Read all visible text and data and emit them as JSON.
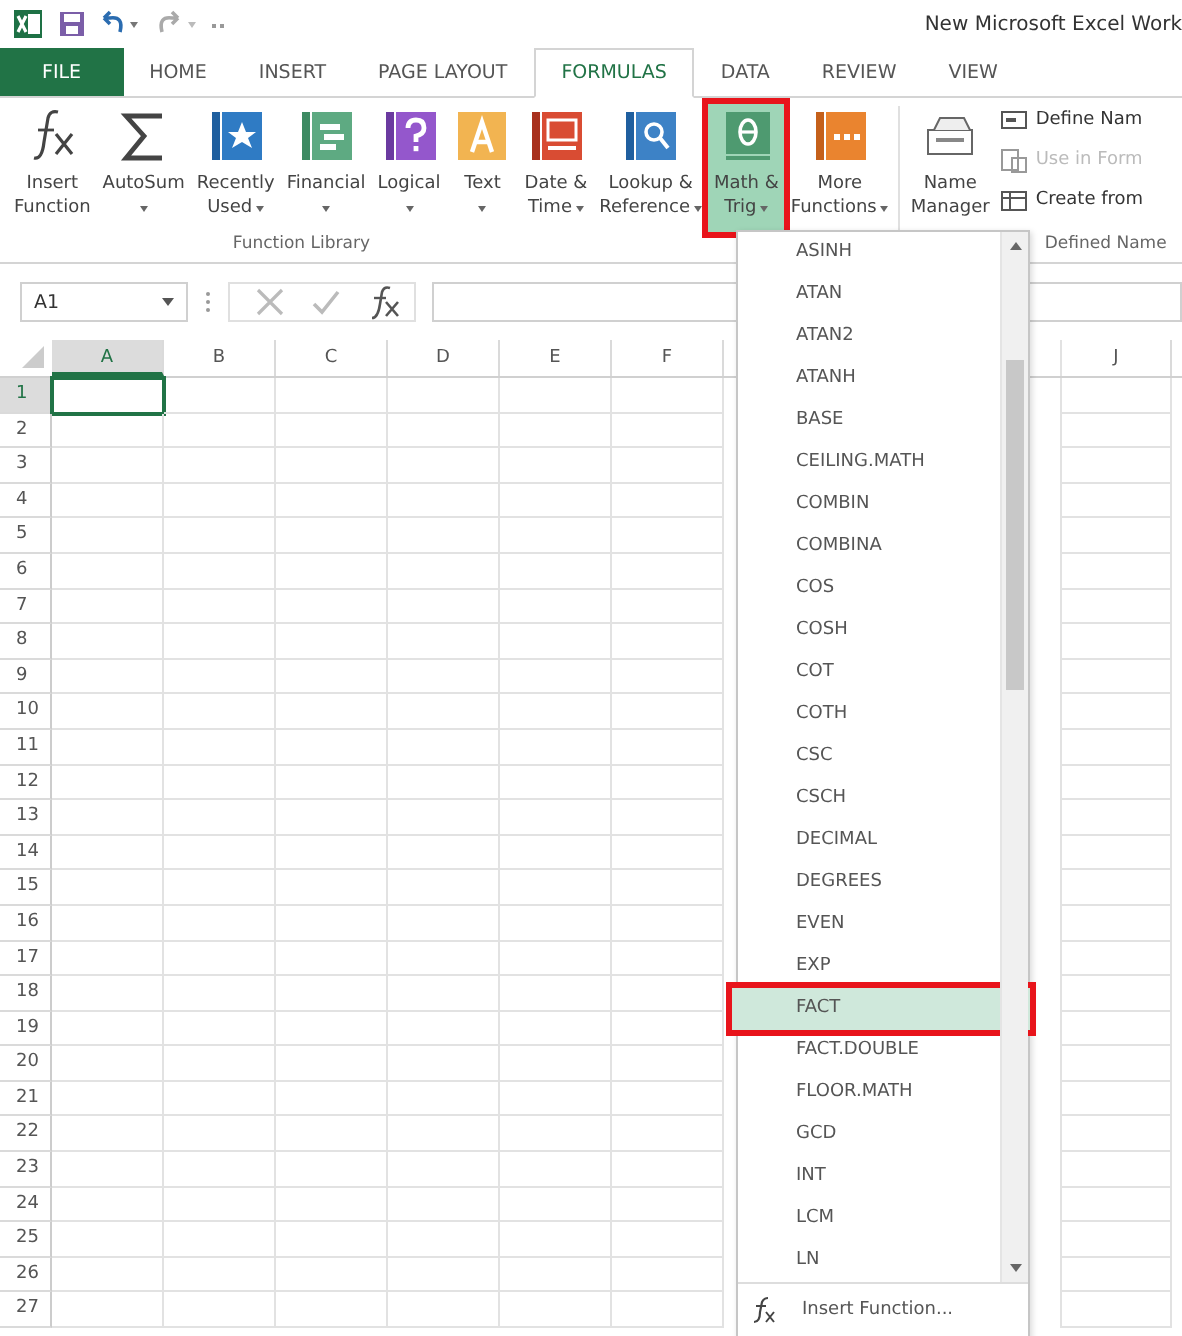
{
  "window": {
    "title": "New Microsoft Excel Work"
  },
  "tabs": [
    {
      "label": "FILE",
      "kind": "file",
      "selected": false
    },
    {
      "label": "HOME",
      "kind": "tab",
      "selected": false
    },
    {
      "label": "INSERT",
      "kind": "tab",
      "selected": false
    },
    {
      "label": "PAGE LAYOUT",
      "kind": "tab",
      "selected": false
    },
    {
      "label": "FORMULAS",
      "kind": "tab",
      "selected": true
    },
    {
      "label": "DATA",
      "kind": "tab",
      "selected": false
    },
    {
      "label": "REVIEW",
      "kind": "tab",
      "selected": false
    },
    {
      "label": "VIEW",
      "kind": "tab",
      "selected": false
    }
  ],
  "ribbon": {
    "function_library": {
      "label": "Function Library",
      "buttons": [
        {
          "lines": [
            "Insert",
            "Function"
          ],
          "kind": "fx",
          "dropdown": false,
          "selected": false,
          "annotated": false
        },
        {
          "lines": [
            "AutoSum"
          ],
          "kind": "sigma",
          "dropdown": true,
          "selected": false,
          "annotated": false
        },
        {
          "lines": [
            "Recently",
            "Used"
          ],
          "kind": "star",
          "dropdown": true,
          "selected": false,
          "annotated": false
        },
        {
          "lines": [
            "Financial"
          ],
          "kind": "financial",
          "dropdown": true,
          "selected": false,
          "annotated": false
        },
        {
          "lines": [
            "Logical"
          ],
          "kind": "logical",
          "dropdown": true,
          "selected": false,
          "annotated": false
        },
        {
          "lines": [
            "Text"
          ],
          "kind": "text",
          "dropdown": true,
          "selected": false,
          "annotated": false
        },
        {
          "lines": [
            "Date &",
            "Time"
          ],
          "kind": "date",
          "dropdown": true,
          "selected": false,
          "annotated": false
        },
        {
          "lines": [
            "Lookup &",
            "Reference"
          ],
          "kind": "lookup",
          "dropdown": true,
          "selected": false,
          "annotated": false
        },
        {
          "lines": [
            "Math &",
            "Trig"
          ],
          "kind": "math",
          "dropdown": true,
          "selected": true,
          "annotated": true
        },
        {
          "lines": [
            "More",
            "Functions"
          ],
          "kind": "more",
          "dropdown": true,
          "selected": false,
          "annotated": false
        }
      ]
    },
    "defined_names": {
      "label": "Defined Name",
      "name_manager": [
        "Name",
        "Manager"
      ],
      "items": [
        {
          "label": "Define Nam",
          "kind": "tag",
          "disabled": false
        },
        {
          "label": "Use in Form",
          "kind": "use",
          "disabled": true
        },
        {
          "label": "Create from",
          "kind": "grid",
          "disabled": false
        }
      ]
    }
  },
  "formula_bar": {
    "name_box": "A1"
  },
  "sheet": {
    "columns": [
      {
        "label": "A",
        "selected": true
      },
      {
        "label": "B",
        "selected": false
      },
      {
        "label": "C",
        "selected": false
      },
      {
        "label": "D",
        "selected": false
      },
      {
        "label": "E",
        "selected": false
      },
      {
        "label": "F",
        "selected": false
      },
      {
        "label": "J",
        "selected": false
      }
    ],
    "rows": [
      {
        "label": "1",
        "selected": true
      },
      {
        "label": "2",
        "selected": false
      },
      {
        "label": "3",
        "selected": false
      },
      {
        "label": "4",
        "selected": false
      },
      {
        "label": "5",
        "selected": false
      },
      {
        "label": "6",
        "selected": false
      },
      {
        "label": "7",
        "selected": false
      },
      {
        "label": "8",
        "selected": false
      },
      {
        "label": "9",
        "selected": false
      },
      {
        "label": "10",
        "selected": false
      },
      {
        "label": "11",
        "selected": false
      },
      {
        "label": "12",
        "selected": false
      },
      {
        "label": "13",
        "selected": false
      },
      {
        "label": "14",
        "selected": false
      },
      {
        "label": "15",
        "selected": false
      },
      {
        "label": "16",
        "selected": false
      },
      {
        "label": "17",
        "selected": false
      },
      {
        "label": "18",
        "selected": false
      },
      {
        "label": "19",
        "selected": false
      },
      {
        "label": "20",
        "selected": false
      },
      {
        "label": "21",
        "selected": false
      },
      {
        "label": "22",
        "selected": false
      },
      {
        "label": "23",
        "selected": false
      },
      {
        "label": "24",
        "selected": false
      },
      {
        "label": "25",
        "selected": false
      },
      {
        "label": "26",
        "selected": false
      },
      {
        "label": "27",
        "selected": false
      }
    ]
  },
  "dropdown": {
    "items": [
      {
        "label": "ASINH",
        "selected": false,
        "annotated": false
      },
      {
        "label": "ATAN",
        "selected": false,
        "annotated": false
      },
      {
        "label": "ATAN2",
        "selected": false,
        "annotated": false
      },
      {
        "label": "ATANH",
        "selected": false,
        "annotated": false
      },
      {
        "label": "BASE",
        "selected": false,
        "annotated": false
      },
      {
        "label": "CEILING.MATH",
        "selected": false,
        "annotated": false
      },
      {
        "label": "COMBIN",
        "selected": false,
        "annotated": false
      },
      {
        "label": "COMBINA",
        "selected": false,
        "annotated": false
      },
      {
        "label": "COS",
        "selected": false,
        "annotated": false
      },
      {
        "label": "COSH",
        "selected": false,
        "annotated": false
      },
      {
        "label": "COT",
        "selected": false,
        "annotated": false
      },
      {
        "label": "COTH",
        "selected": false,
        "annotated": false
      },
      {
        "label": "CSC",
        "selected": false,
        "annotated": false
      },
      {
        "label": "CSCH",
        "selected": false,
        "annotated": false
      },
      {
        "label": "DECIMAL",
        "selected": false,
        "annotated": false
      },
      {
        "label": "DEGREES",
        "selected": false,
        "annotated": false
      },
      {
        "label": "EVEN",
        "selected": false,
        "annotated": false
      },
      {
        "label": "EXP",
        "selected": false,
        "annotated": false
      },
      {
        "label": "FACT",
        "selected": true,
        "annotated": true
      },
      {
        "label": "FACT.DOUBLE",
        "selected": false,
        "annotated": false
      },
      {
        "label": "FLOOR.MATH",
        "selected": false,
        "annotated": false
      },
      {
        "label": "GCD",
        "selected": false,
        "annotated": false
      },
      {
        "label": "INT",
        "selected": false,
        "annotated": false
      },
      {
        "label": "LCM",
        "selected": false,
        "annotated": false
      },
      {
        "label": "LN",
        "selected": false,
        "annotated": false
      }
    ],
    "footer": "Insert Function..."
  }
}
